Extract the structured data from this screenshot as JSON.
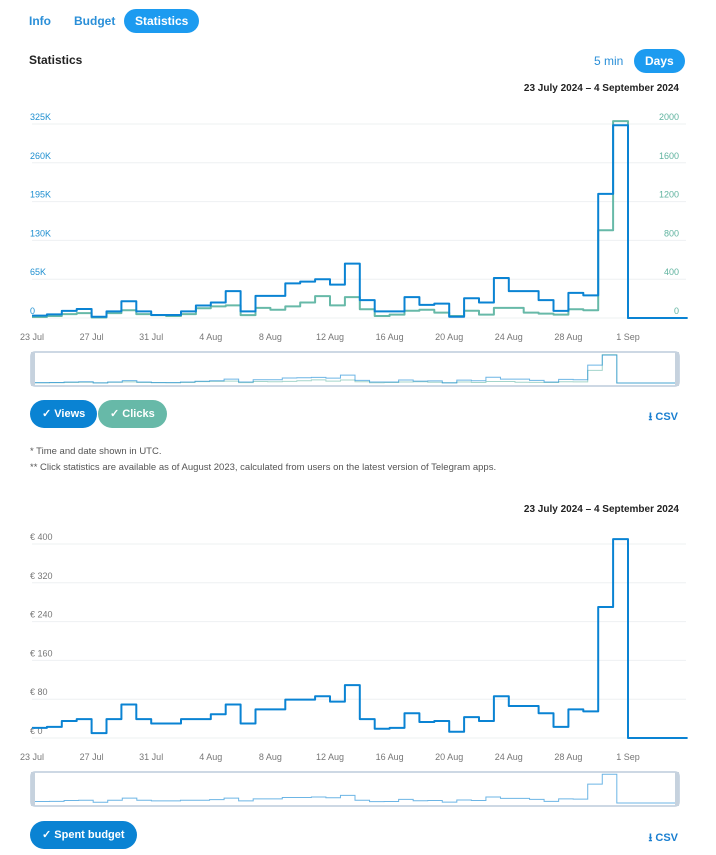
{
  "tabs": [
    {
      "label": "Info"
    },
    {
      "label": "Budget"
    },
    {
      "label": "Statistics",
      "active": true
    }
  ],
  "section_title": "Statistics",
  "granularity": {
    "options": [
      "5 min",
      "Days"
    ],
    "selected": "Days"
  },
  "colors": {
    "accent": "#1c9bf0",
    "views": "#0a83d3",
    "clicks": "#67b9a8",
    "budget": "#0a83d3"
  },
  "chart_data": [
    {
      "type": "line",
      "step": true,
      "date_range": "23 July 2024 – 4 September 2024",
      "x_ticks": [
        "23 Jul",
        "27 Jul",
        "31 Jul",
        "4 Aug",
        "8 Aug",
        "12 Aug",
        "16 Aug",
        "20 Aug",
        "24 Aug",
        "28 Aug",
        "1 Sep"
      ],
      "x_start": "2024-07-23",
      "x_end": "2024-09-04",
      "y_left": {
        "ticks": [
          "0",
          "65K",
          "130K",
          "195K",
          "260K",
          "325K"
        ],
        "range": [
          0,
          325000
        ]
      },
      "y_right": {
        "ticks": [
          "0",
          "400",
          "800",
          "1200",
          "1600",
          "2000"
        ],
        "range": [
          0,
          2000
        ]
      },
      "grid": true,
      "series": [
        {
          "name": "Views",
          "axis": "left",
          "color": "#0a83d3",
          "values": [
            4000,
            6000,
            12000,
            15000,
            2000,
            11000,
            28000,
            11000,
            5000,
            5000,
            11000,
            21000,
            26000,
            45000,
            11000,
            37000,
            37000,
            58000,
            61000,
            65000,
            56000,
            91000,
            30000,
            11000,
            11000,
            35000,
            22000,
            24000,
            2000,
            33000,
            26000,
            67000,
            45000,
            45000,
            30000,
            12000,
            42000,
            38000,
            208000,
            323000,
            0,
            0,
            0,
            0
          ]
        },
        {
          "name": "Clicks",
          "axis": "right",
          "color": "#67b9a8",
          "values": [
            10,
            20,
            40,
            50,
            5,
            50,
            80,
            40,
            30,
            20,
            40,
            100,
            120,
            130,
            30,
            105,
            85,
            120,
            160,
            225,
            130,
            215,
            90,
            20,
            35,
            75,
            85,
            55,
            20,
            75,
            35,
            105,
            105,
            55,
            45,
            35,
            90,
            80,
            905,
            2030,
            0,
            0,
            0,
            0
          ]
        }
      ],
      "legend": [
        {
          "label": "Views",
          "checked": true
        },
        {
          "label": "Clicks",
          "checked": true
        }
      ],
      "csv_label": "CSV"
    },
    {
      "type": "line",
      "step": true,
      "date_range": "23 July 2024 – 4 September 2024",
      "x_ticks": [
        "23 Jul",
        "27 Jul",
        "31 Jul",
        "4 Aug",
        "8 Aug",
        "12 Aug",
        "16 Aug",
        "20 Aug",
        "24 Aug",
        "28 Aug",
        "1 Sep"
      ],
      "x_start": "2024-07-23",
      "x_end": "2024-09-04",
      "y_left": {
        "ticks": [
          "€ 0",
          "€ 80",
          "€ 160",
          "€ 240",
          "€ 320",
          "€ 400"
        ],
        "range": [
          0,
          400
        ]
      },
      "grid": true,
      "series": [
        {
          "name": "Spent budget",
          "axis": "left",
          "color": "#0a83d3",
          "values": [
            21,
            23,
            35,
            39,
            10,
            39,
            69,
            39,
            30,
            30,
            39,
            39,
            49,
            69,
            30,
            59,
            59,
            79,
            79,
            86,
            75,
            109,
            39,
            19,
            21,
            51,
            33,
            35,
            13,
            43,
            35,
            86,
            66,
            66,
            51,
            23,
            59,
            55,
            270,
            410,
            0,
            0,
            0,
            0
          ]
        }
      ],
      "legend": [
        {
          "label": "Spent budget",
          "checked": true
        }
      ],
      "csv_label": "CSV"
    }
  ],
  "notes": [
    "* Time and date shown in UTC.",
    "** Click statistics are available as of August 2023, calculated from users on the latest version of Telegram apps."
  ]
}
